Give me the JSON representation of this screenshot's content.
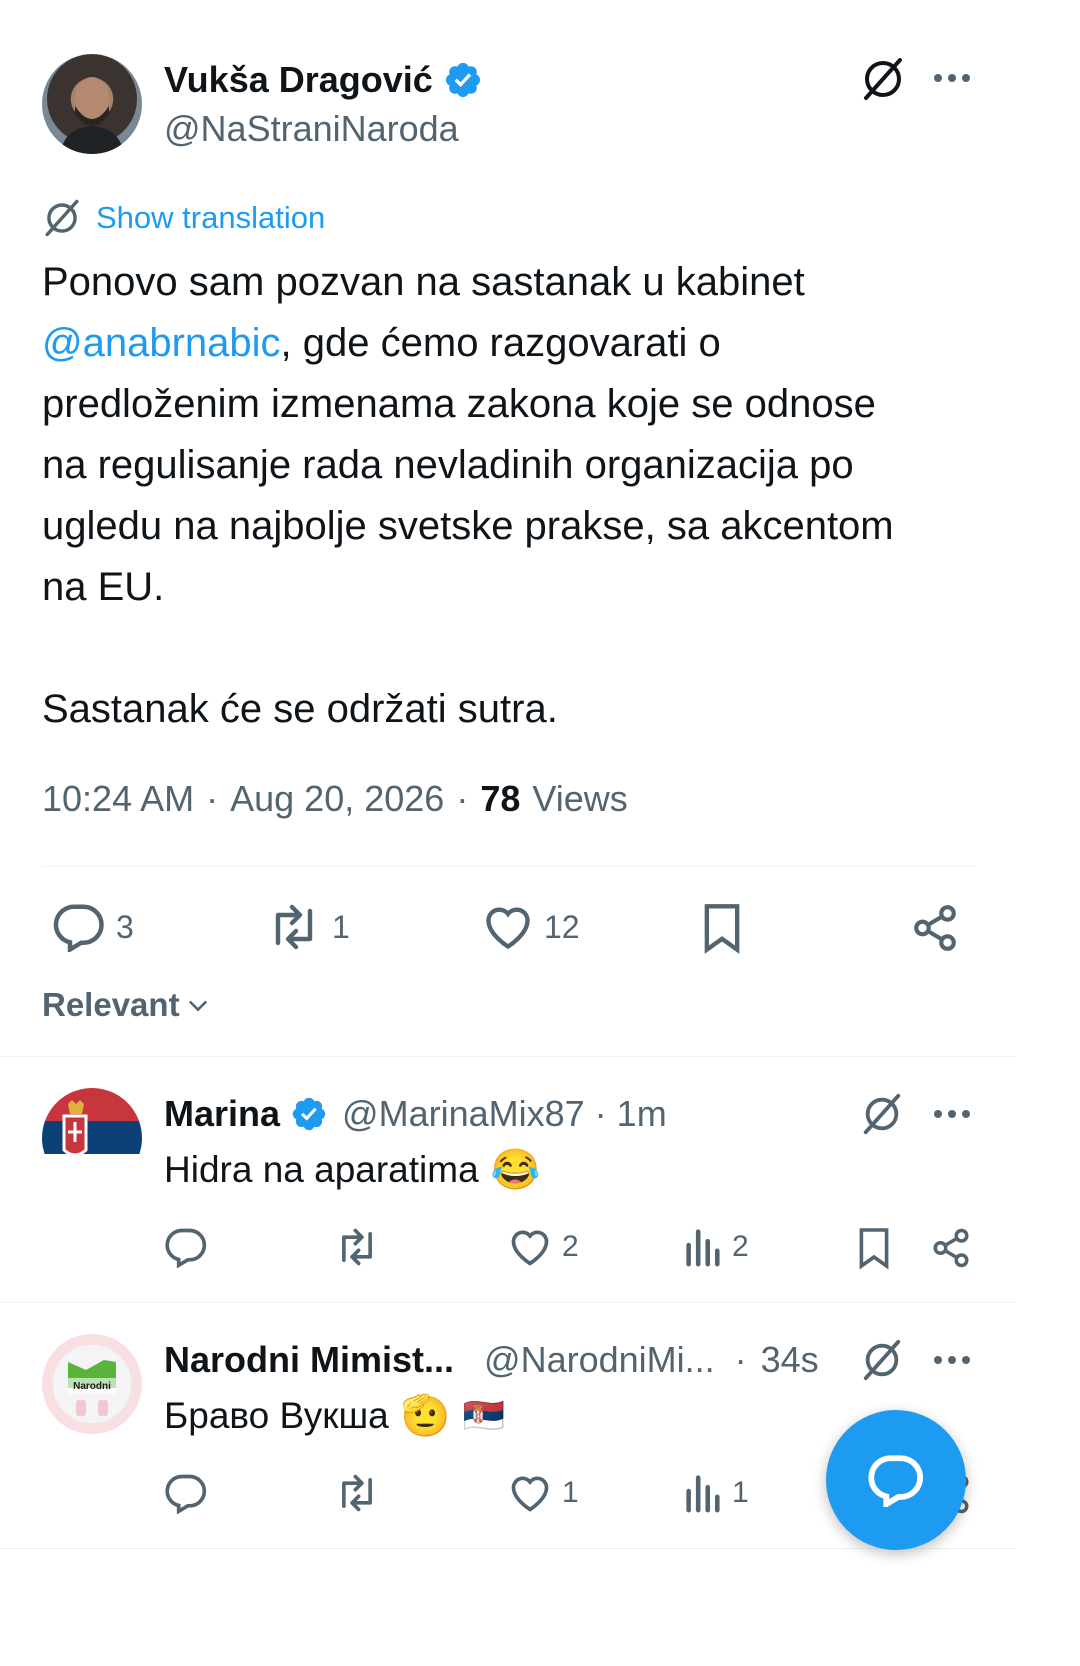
{
  "tweet": {
    "author_name": "Vukša Dragović",
    "author_handle": "@NaStraniNaroda",
    "show_translation": "Show translation",
    "text_line1": "Ponovo sam pozvan na sastanak u kabinet",
    "mention": "@anabrnabic",
    "text_line2_rest": ", gde ćemo razgovarati o",
    "text_line3": "predloženim izmenama zakona koje se odnose",
    "text_line4": "na regulisanje rada nevladinih organizacija po",
    "text_line5": "ugledu na najbolje svetske prakse, sa akcentom",
    "text_line6": "na EU.",
    "text_para2": "Sastanak će se održati sutra.",
    "time": "10:24 AM",
    "date": "Aug 20, 2026",
    "sep": "·",
    "views_count": "78",
    "views_label": "Views",
    "reply_count": "3",
    "retweet_count": "1",
    "like_count": "12"
  },
  "sort": {
    "label": "Relevant"
  },
  "replies": [
    {
      "name": "Marina",
      "handle": "@MarinaMix87",
      "dot": "·",
      "time": "1m",
      "text": "Hidra na aparatima",
      "emoji": "😂",
      "like_count": "2",
      "views_count": "2"
    },
    {
      "name": "Narodni Mimist...",
      "handle": "@NarodniMi...",
      "dot": "·",
      "time": "34s",
      "text": "Браво Вукша",
      "emoji": "🫡",
      "flag": "🇷🇸",
      "avatar_text": "Narodni",
      "like_count": "1",
      "views_count": "1"
    }
  ],
  "icons": {
    "grok": "grok-icon",
    "more": "more-icon",
    "verified": "verified-badge-icon",
    "reply": "reply-icon",
    "retweet": "retweet-icon",
    "like": "like-icon",
    "bookmark": "bookmark-icon",
    "share": "share-icon",
    "views": "views-icon",
    "compose": "compose-reply-icon"
  },
  "colors": {
    "accent": "#1d9bf0",
    "text": "#0f1419",
    "muted": "#536471",
    "divider": "#eff3f4"
  }
}
